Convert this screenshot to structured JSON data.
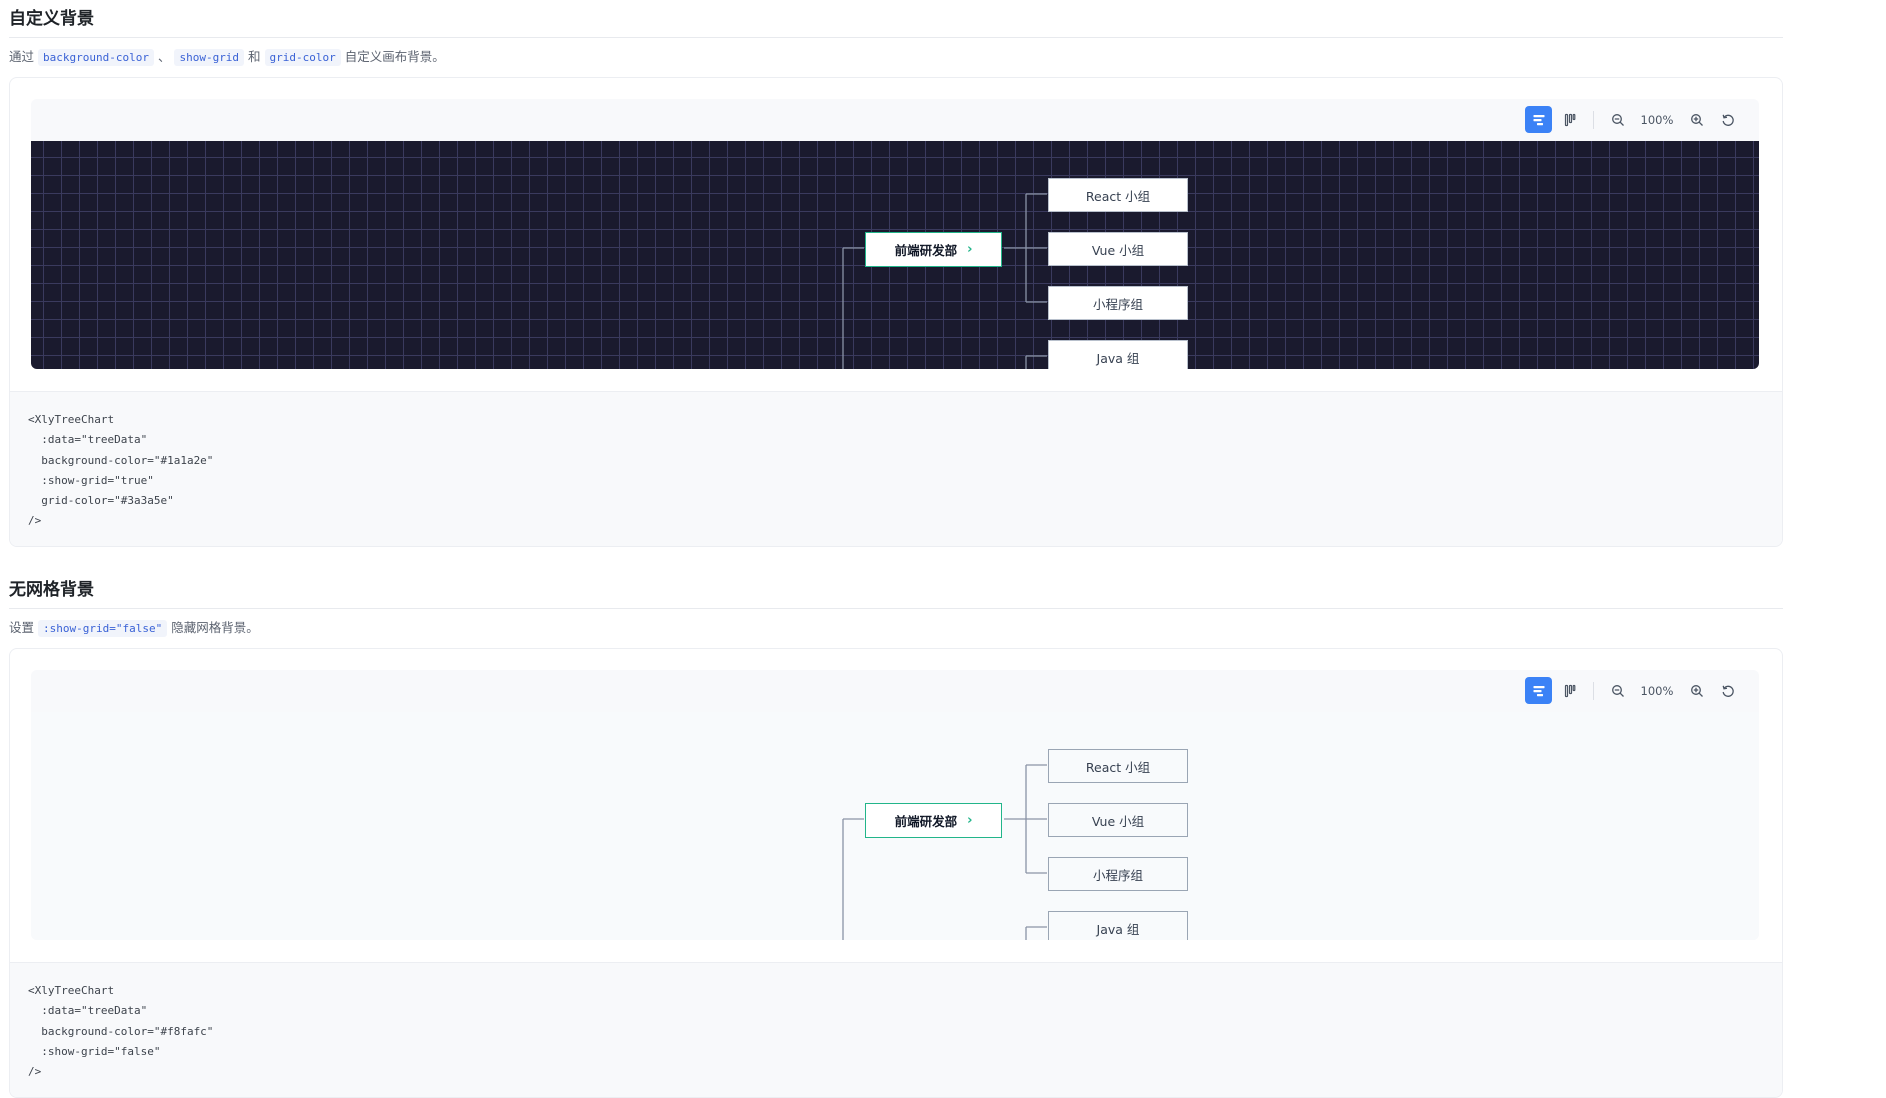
{
  "sections": [
    {
      "title": "自定义背景",
      "desc_prefix": "通过",
      "desc_code1": "background-color",
      "desc_sep1": "、",
      "desc_code2": "show-grid",
      "desc_sep2": "和",
      "desc_code3": "grid-color",
      "desc_suffix": "自定义画布背景。",
      "zoom": "100%",
      "tree": {
        "root": "前端研发部",
        "children": [
          "React 小组",
          "Vue 小组",
          "小程序组",
          "Java 组"
        ]
      },
      "code_lines": [
        "<XlyTreeChart",
        "  :data=\"treeData\"",
        "  background-color=\"#1a1a2e\"",
        "  :show-grid=\"true\"",
        "  grid-color=\"#3a3a5e\"",
        "/>"
      ],
      "colors": {
        "background": "#1a1a2e",
        "grid": "#3a3a5e"
      }
    },
    {
      "title": "无网格背景",
      "desc_prefix": "设置",
      "desc_code1": ":show-grid=\"false\"",
      "desc_suffix": "隐藏网格背景。",
      "zoom": "100%",
      "tree": {
        "root": "前端研发部",
        "children": [
          "React 小组",
          "Vue 小组",
          "小程序组",
          "Java 组"
        ]
      },
      "code_lines": [
        "<XlyTreeChart",
        "  :data=\"treeData\"",
        "  background-color=\"#f8fafc\"",
        "  :show-grid=\"false\"",
        "/>"
      ],
      "colors": {
        "background": "#f8fafc"
      }
    }
  ],
  "toolbar_icons": [
    "horizontal-layout-icon",
    "vertical-layout-icon",
    "zoom-out-icon",
    "zoom-in-icon",
    "reset-icon"
  ],
  "accent": "#3b82f6",
  "root_border": "#22b58a"
}
